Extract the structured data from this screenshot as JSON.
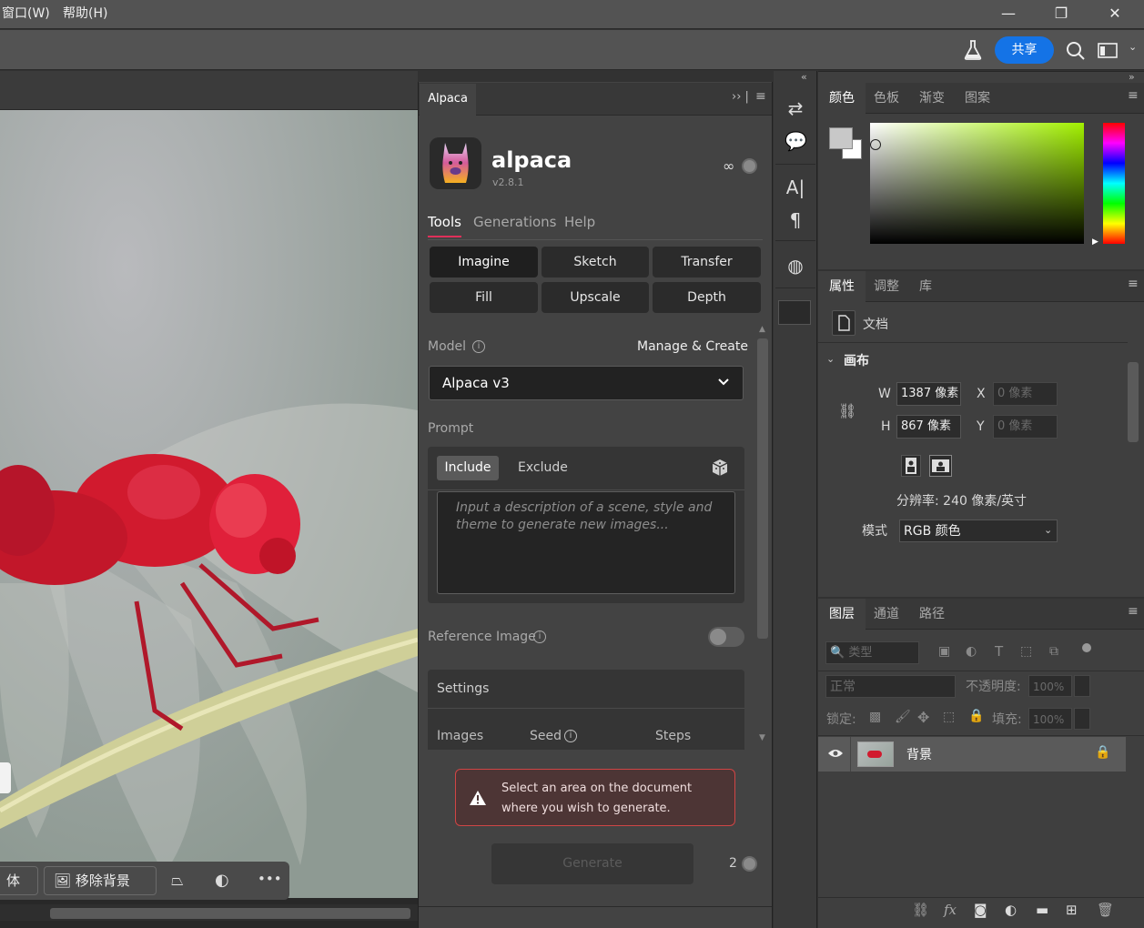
{
  "menu": {
    "window": "窗口(W)",
    "help": "帮助(H)"
  },
  "window_controls": {
    "minimize": "—",
    "restore": "❐",
    "close": "✕"
  },
  "toolbar": {
    "share": "共享"
  },
  "context_bar": {
    "partial_label": "体",
    "remove_bg": "移除背景",
    "more": "•••"
  },
  "alpaca": {
    "tab_title": "Alpaca",
    "app_name": "alpaca",
    "version": "v2.8.1",
    "credits_symbol": "∞",
    "nav": {
      "tools": "Tools",
      "generations": "Generations",
      "help": "Help"
    },
    "tool_buttons": [
      "Imagine",
      "Sketch",
      "Transfer",
      "Fill",
      "Upscale",
      "Depth"
    ],
    "model_label": "Model",
    "manage_create": "Manage & Create",
    "model_value": "Alpaca v3",
    "prompt_label": "Prompt",
    "include": "Include",
    "exclude": "Exclude",
    "prompt_placeholder": "Input a description of a scene, style and theme to generate new images...",
    "reference_image": "Reference Image",
    "settings": "Settings",
    "images": "Images",
    "seed": "Seed",
    "steps": "Steps",
    "warning": "Select an area on the document where you wish to generate.",
    "generate": "Generate",
    "count": "2"
  },
  "color_panel": {
    "tabs": [
      "颜色",
      "色板",
      "渐变",
      "图案"
    ]
  },
  "properties_panel": {
    "tabs": [
      "属性",
      "调整",
      "库"
    ],
    "doc_label": "文档",
    "canvas_section": "画布",
    "w_label": "W",
    "w_value": "1387 像素",
    "h_label": "H",
    "h_value": "867 像素",
    "x_label": "X",
    "x_value": "0 像素",
    "y_label": "Y",
    "y_value": "0 像素",
    "resolution": "分辨率: 240 像素/英寸",
    "mode_label": "模式",
    "mode_value": "RGB 颜色"
  },
  "layers_panel": {
    "tabs": [
      "图层",
      "通道",
      "路径"
    ],
    "filter_kind": "类型",
    "blend_mode": "正常",
    "opacity_label": "不透明度:",
    "opacity_value": "100%",
    "lock_label": "锁定:",
    "fill_label": "填充:",
    "fill_value": "100%",
    "layer_name": "背景"
  },
  "colors": {
    "accent": "#1473e6",
    "alpaca_underline": "#e0305a",
    "warning_border": "#d04545",
    "dragonfly": "#d11a2e"
  }
}
